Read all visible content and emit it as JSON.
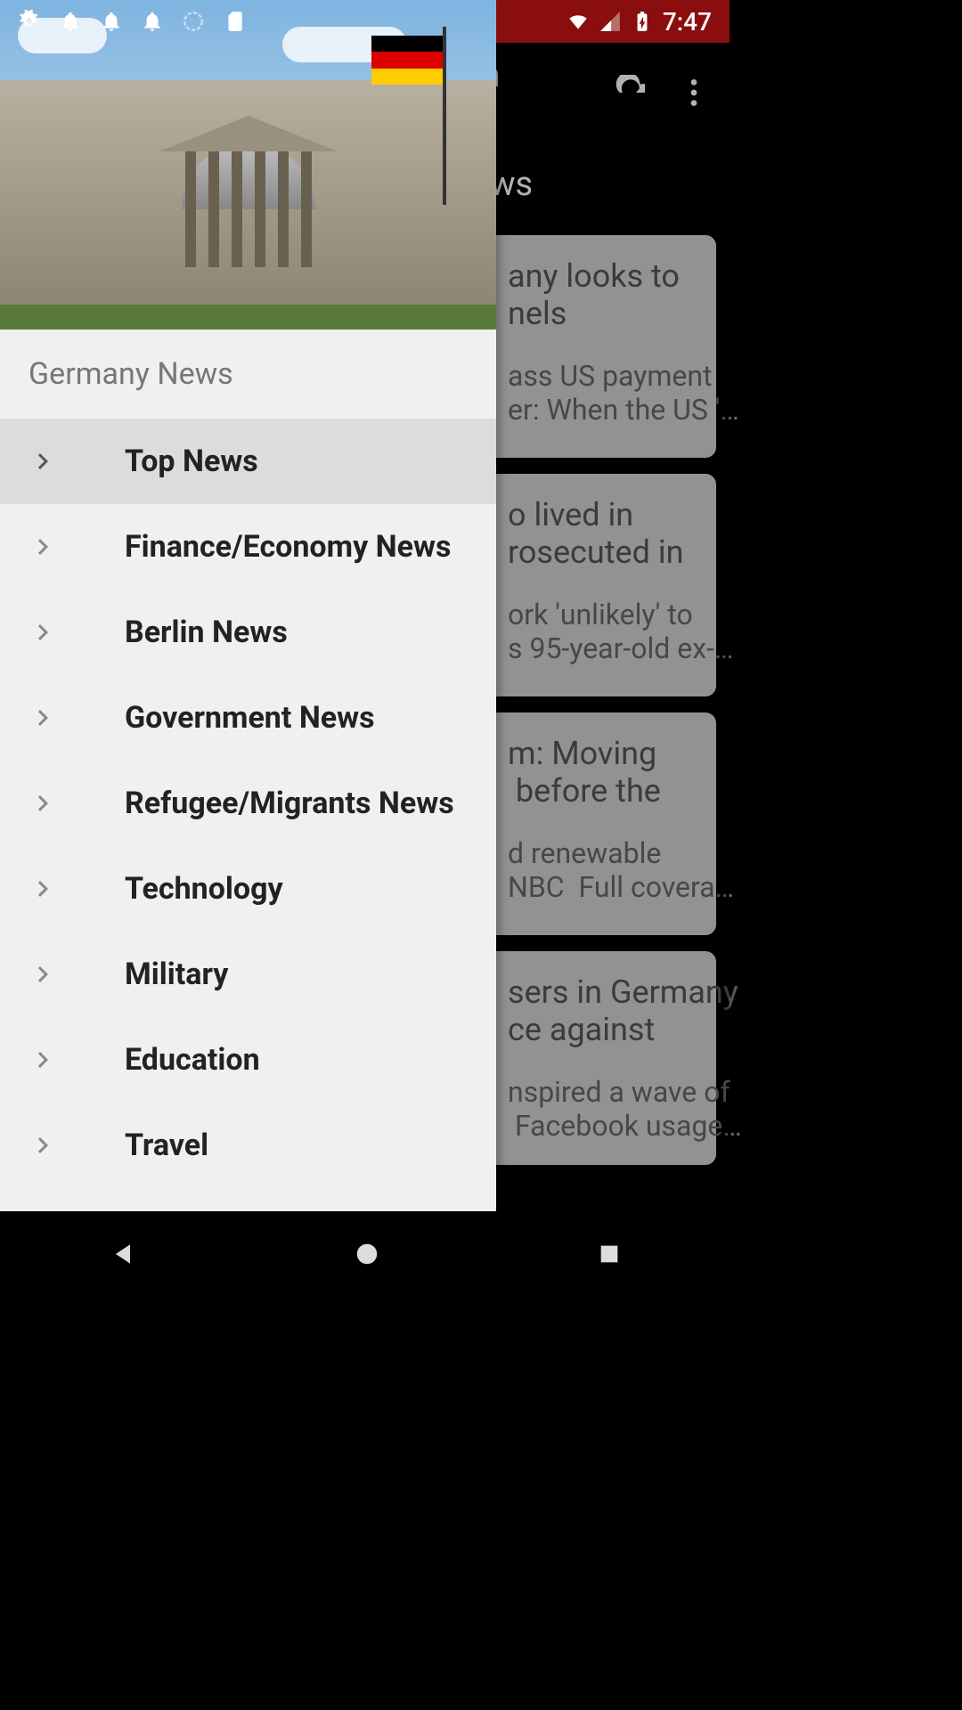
{
  "status_bar": {
    "time": "7:47"
  },
  "app_bar": {
    "title_visible_part": "h"
  },
  "section_header_visible": "ws",
  "drawer": {
    "title": "Germany News",
    "items": [
      {
        "label": "Top News",
        "active": true
      },
      {
        "label": "Finance/Economy News",
        "active": false
      },
      {
        "label": "Berlin News",
        "active": false
      },
      {
        "label": "Government News",
        "active": false
      },
      {
        "label": "Refugee/Migrants News",
        "active": false
      },
      {
        "label": "Technology",
        "active": false
      },
      {
        "label": "Military",
        "active": false
      },
      {
        "label": "Education",
        "active": false
      },
      {
        "label": "Travel",
        "active": false
      }
    ]
  },
  "news_cards": [
    {
      "title_frag": "any looks to\nnels",
      "desc_frag": "ass US payment\ner: When the US '…"
    },
    {
      "title_frag": "o lived in\nrosecuted in",
      "desc_frag": "ork 'unlikely' to\ns 95-year-old ex-…"
    },
    {
      "title_frag": "m: Moving\n before the",
      "desc_frag": "d renewable\nNBC  Full covera…"
    },
    {
      "title_frag": "sers in Germany\nce against",
      "desc_frag": "nspired a wave of\n Facebook usage…"
    }
  ]
}
